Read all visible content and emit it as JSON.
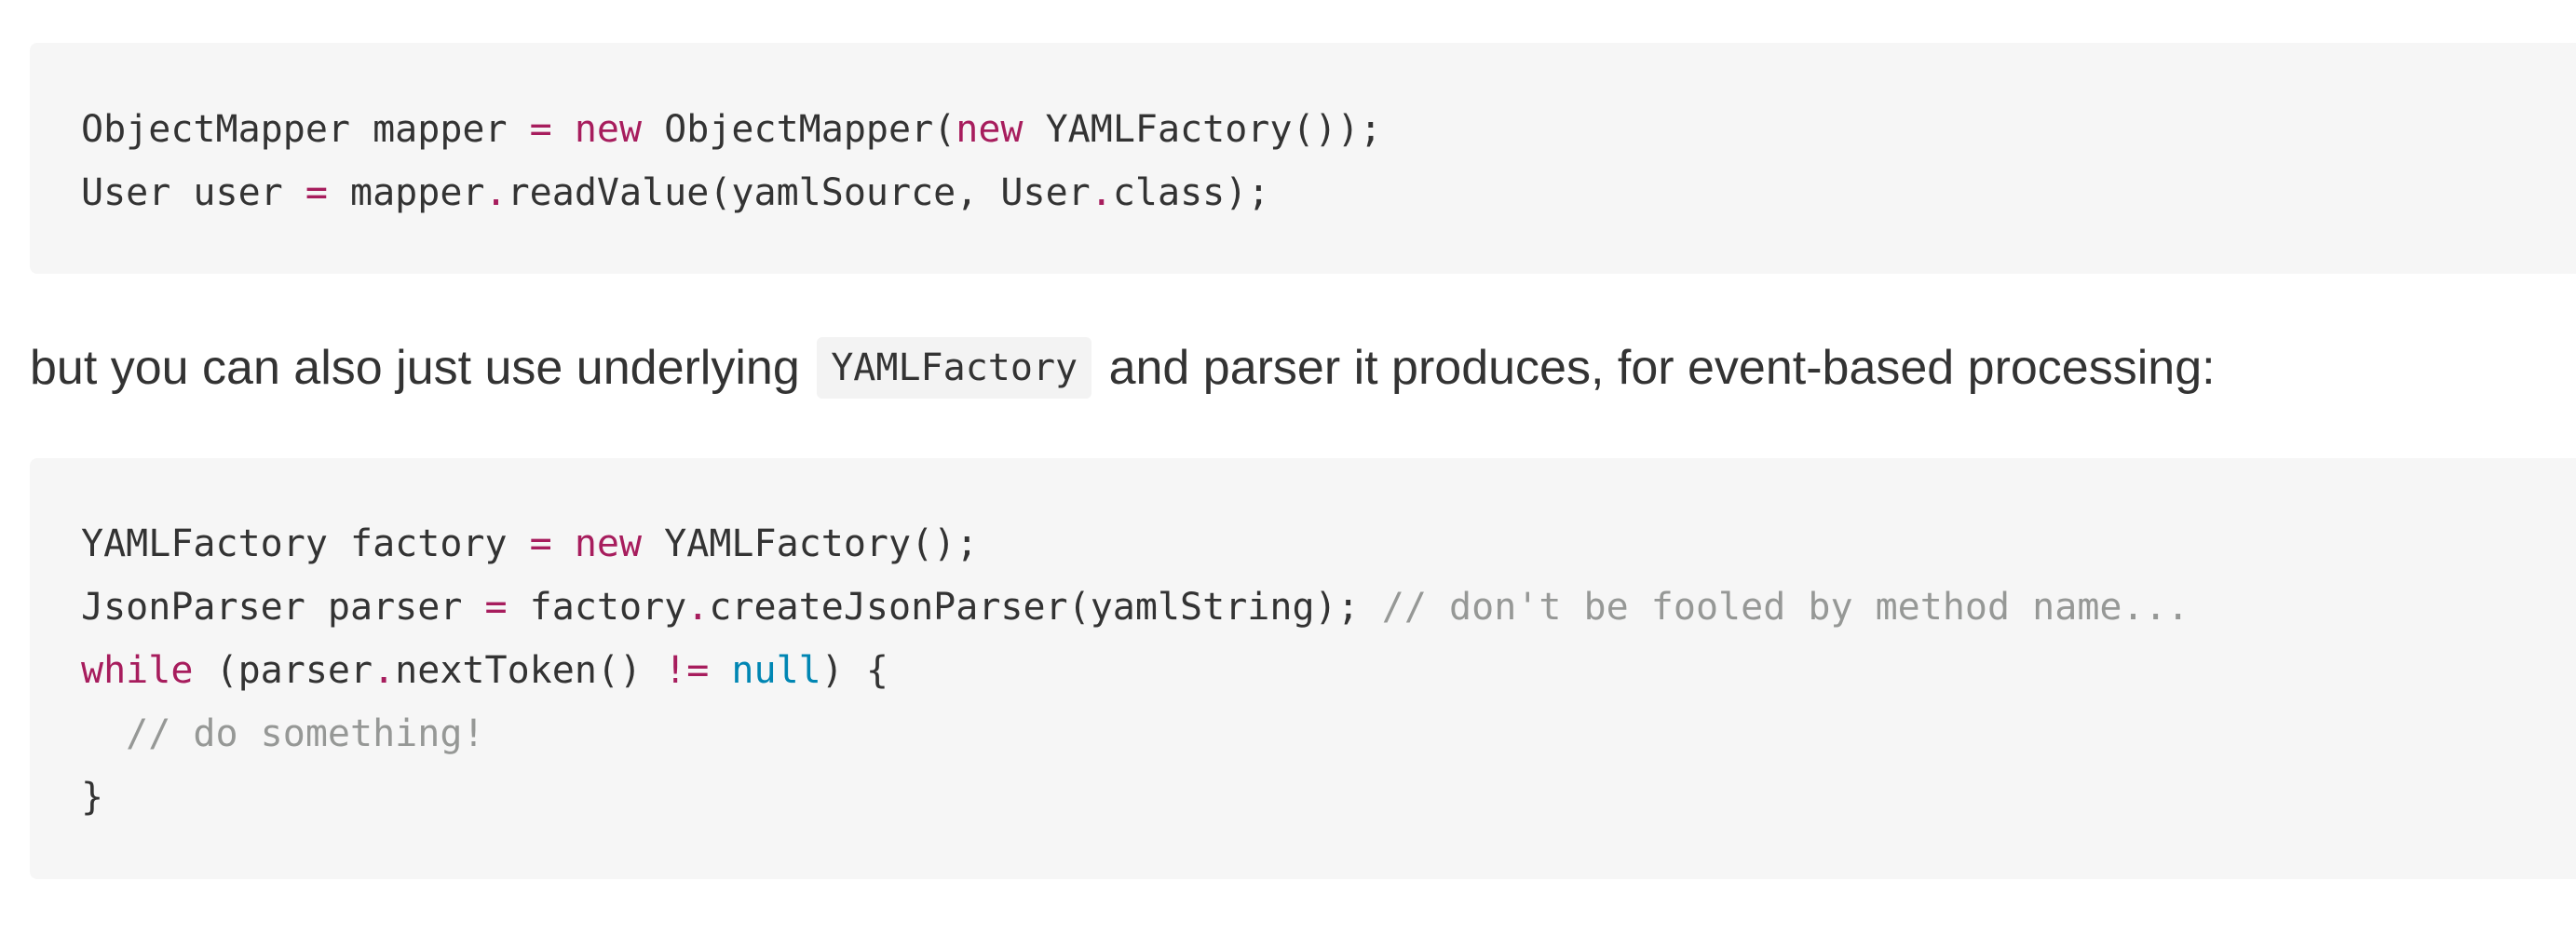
{
  "block1": {
    "lines": [
      [
        {
          "t": "ObjectMapper mapper ",
          "c": "plain"
        },
        {
          "t": "=",
          "c": "op"
        },
        {
          "t": " ",
          "c": "plain"
        },
        {
          "t": "new",
          "c": "kw"
        },
        {
          "t": " ObjectMapper(",
          "c": "plain"
        },
        {
          "t": "new",
          "c": "kw"
        },
        {
          "t": " YAMLFactory());",
          "c": "plain"
        }
      ],
      [
        {
          "t": "User user ",
          "c": "plain"
        },
        {
          "t": "=",
          "c": "op"
        },
        {
          "t": " mapper",
          "c": "plain"
        },
        {
          "t": ".",
          "c": "op"
        },
        {
          "t": "readValue(yamlSource, User",
          "c": "plain"
        },
        {
          "t": ".",
          "c": "op"
        },
        {
          "t": "class);",
          "c": "plain"
        }
      ]
    ]
  },
  "prose": {
    "before": "but you can also just use underlying",
    "code": "YAMLFactory",
    "after": "and parser it produces, for event-based processing:"
  },
  "block2": {
    "lines": [
      [
        {
          "t": "YAMLFactory factory ",
          "c": "plain"
        },
        {
          "t": "=",
          "c": "op"
        },
        {
          "t": " ",
          "c": "plain"
        },
        {
          "t": "new",
          "c": "kw"
        },
        {
          "t": " YAMLFactory();",
          "c": "plain"
        }
      ],
      [
        {
          "t": "JsonParser parser ",
          "c": "plain"
        },
        {
          "t": "=",
          "c": "op"
        },
        {
          "t": " factory",
          "c": "plain"
        },
        {
          "t": ".",
          "c": "op"
        },
        {
          "t": "createJsonParser(yamlString); ",
          "c": "plain"
        },
        {
          "t": "// don't be fooled by method name...",
          "c": "comment"
        }
      ],
      [
        {
          "t": "while",
          "c": "kw"
        },
        {
          "t": " (parser",
          "c": "plain"
        },
        {
          "t": ".",
          "c": "op"
        },
        {
          "t": "nextToken() ",
          "c": "plain"
        },
        {
          "t": "!=",
          "c": "op"
        },
        {
          "t": " ",
          "c": "plain"
        },
        {
          "t": "null",
          "c": "const"
        },
        {
          "t": ") {",
          "c": "plain"
        }
      ],
      [
        {
          "t": "  ",
          "c": "plain"
        },
        {
          "t": "// do something!",
          "c": "comment"
        }
      ],
      [
        {
          "t": "}",
          "c": "plain"
        }
      ]
    ]
  },
  "colors": {
    "keyword": "#a71d5d",
    "operator": "#a71d5d",
    "constant": "#0086b3",
    "comment": "#969896",
    "text": "#333333",
    "code_background": "#f6f6f6"
  }
}
